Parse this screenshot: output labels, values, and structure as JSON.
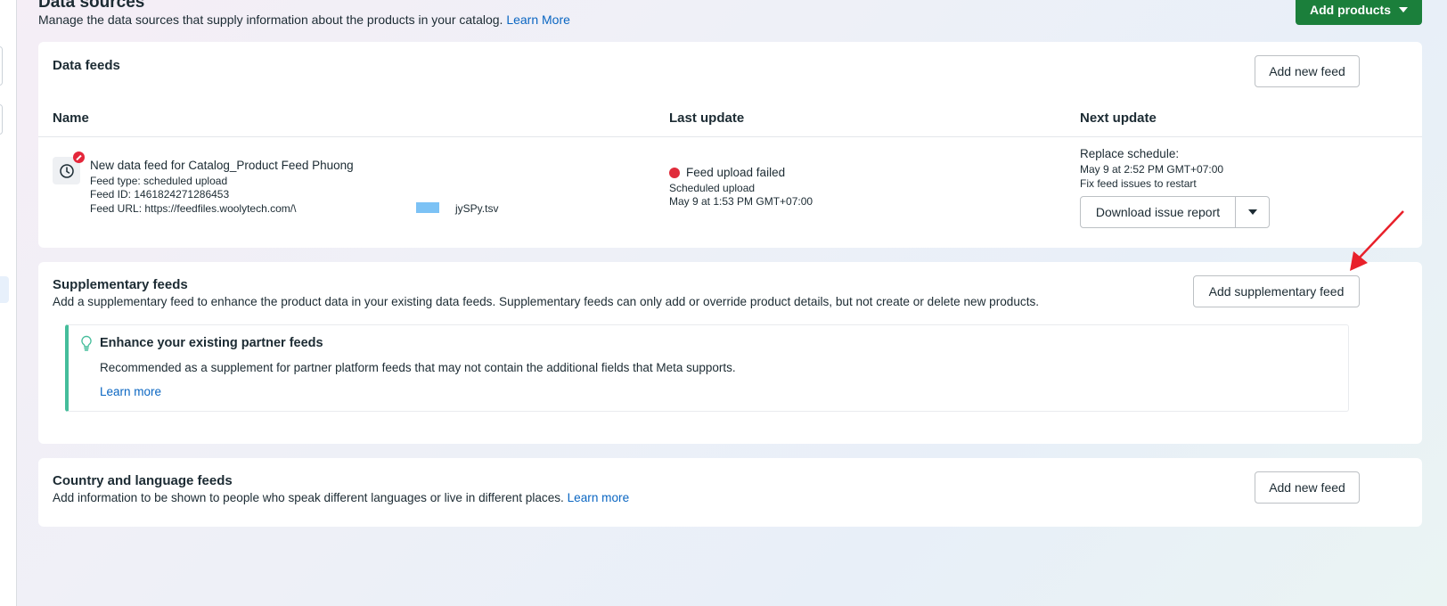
{
  "header": {
    "title": "Data sources",
    "subtitle": "Manage the data sources that supply information about the products in your catalog.",
    "learn_more": "Learn More",
    "add_products": "Add products"
  },
  "data_feeds": {
    "title": "Data feeds",
    "add_button": "Add new feed",
    "columns": [
      "Name",
      "Last update",
      "Next update"
    ],
    "feed": {
      "name": "New data feed for Catalog_Product Feed Phuong",
      "type": "Feed type: scheduled upload",
      "id": "Feed ID: 1461824271286453",
      "url": "Feed URL: https://feedfiles.woolytech.com/\\",
      "url_tail": "jySPy.tsv",
      "status": "Feed upload failed",
      "last_type": "Scheduled upload",
      "last_time": "May 9 at 1:53 PM GMT+07:00",
      "next_label": "Replace schedule:",
      "next_time": "May 9 at 2:52 PM GMT+07:00",
      "next_note": "Fix feed issues to restart",
      "download_button": "Download issue report",
      "status_color": "#e02c3b"
    }
  },
  "supplementary": {
    "title": "Supplementary feeds",
    "description": "Add a supplementary feed to enhance the product data in your existing data feeds. Supplementary feeds can only add or override product details, but not create or delete new products.",
    "add_button": "Add supplementary feed",
    "tip": {
      "title": "Enhance your existing partner feeds",
      "text": "Recommended as a supplement for partner platform feeds that may not contain the additional fields that Meta supports.",
      "link": "Learn more",
      "accent": "#45bd9b"
    }
  },
  "country": {
    "title": "Country and language feeds",
    "description": "Add information to be shown to people who speak different languages or live in different places.",
    "link": "Learn more",
    "add_button": "Add new feed"
  },
  "colors": {
    "primary_button": "#1b7f3b",
    "link": "#0a66c2",
    "annotation_arrow": "#e8202a"
  }
}
